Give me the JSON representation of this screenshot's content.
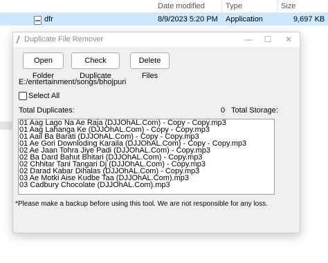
{
  "explorer": {
    "columns": {
      "date_modified": "Date modified",
      "type": "Type",
      "size": "Size"
    },
    "row": {
      "name": "dfr",
      "date": "8/9/2023 5:20 PM",
      "type": "Application",
      "size": "9,697 KB"
    }
  },
  "window": {
    "title": "Duplicate File Remover",
    "controls": {
      "minimize": "—",
      "maximize": "☐",
      "close": "✕"
    },
    "buttons": {
      "open_folder": "Open Folder",
      "check_duplicate": "Check Duplicate",
      "delete_files": "Delete Files"
    },
    "path": "E:/entertainment/songs/bhojpuri",
    "select_all_label": "Select All",
    "select_all_checked": false,
    "total_duplicates_label": "Total Duplicates:",
    "total_duplicates_value": "0",
    "total_storage_label": "Total Storage:",
    "files": [
      "01 Aag Lago Na Ae Raja (DJJOhAL.Com) - Copy - Copy.mp3",
      "01 Aag Lahanga Ke (DJJOhAL.Com) - Copy - Copy.mp3",
      "01 Aail Ba Barati (DJJOhAL.Com) - Copy - Copy.mp3",
      "01 Ae Gori Downloding Karaila (DJJOhAL.Com) - Copy - Copy.mp3",
      "02 Ae Jaan Tohra Jiye Padi (DJJOhAL.Com) - Copy.mp3",
      "02 Ba Dard Bahut Bhitari (DJJOhAL.Com) - Copy.mp3",
      "02 Chhitar Tani Tangari Dj (DJJOhAL.Com) - Copy.mp3",
      "02 Darad Kabar Dihalas (DJJOhAL.Com) - Copy.mp3",
      "03 Ae Motki Aise Kudbe Taa (DJJOhAL.Com).mp3",
      "03 Cadbury Chocolate (DJJOhAL.Com).mp3"
    ],
    "disclaimer": "*Please make a backup before using this tool. We are not responsible for any loss."
  }
}
